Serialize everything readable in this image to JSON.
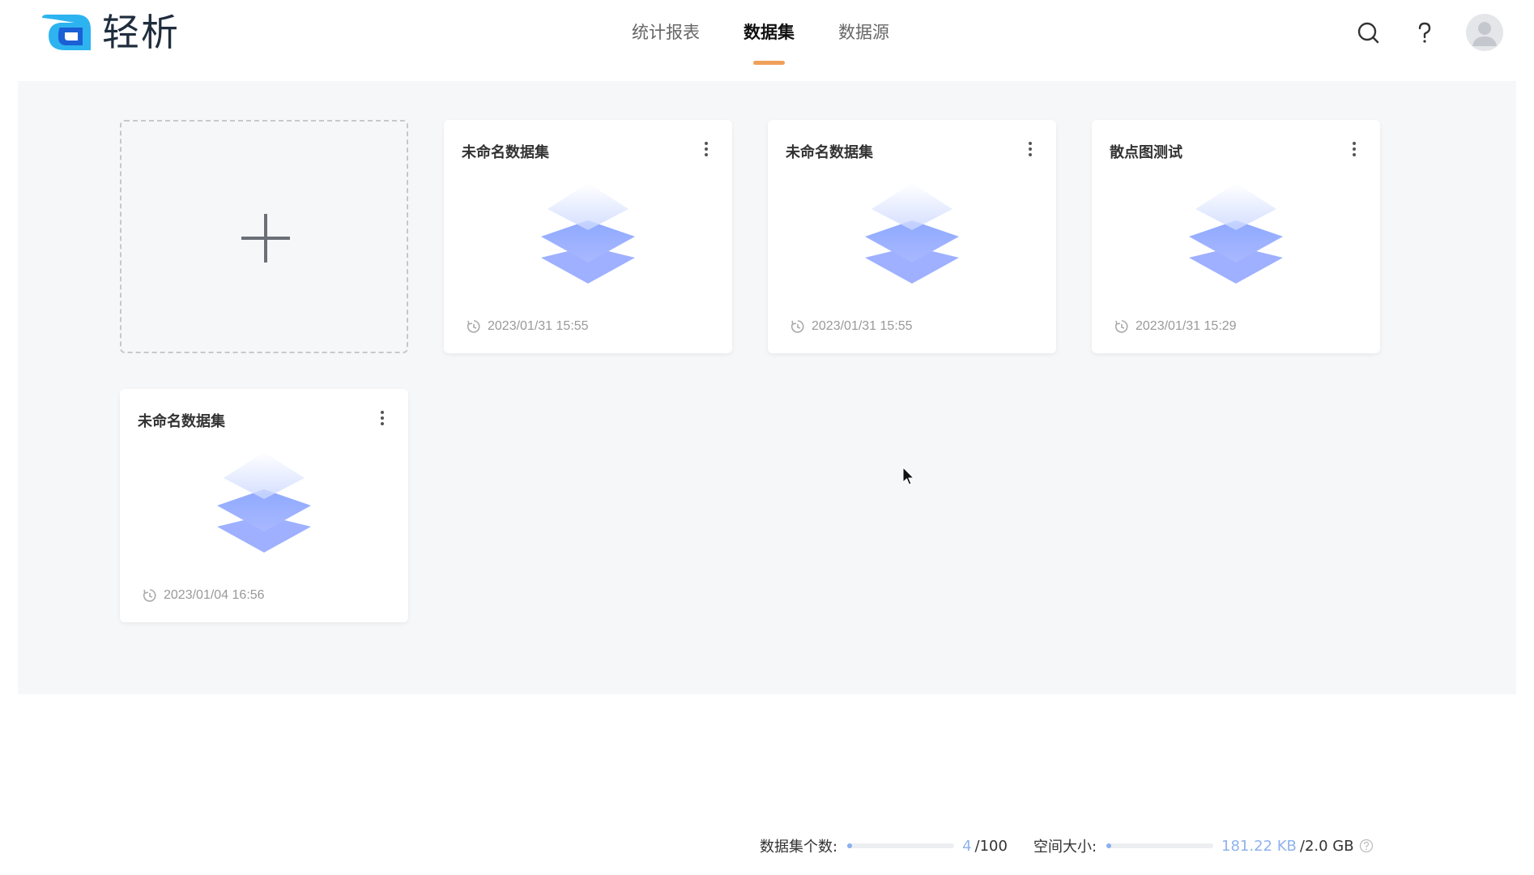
{
  "app": {
    "logo_text": "轻析",
    "brand_colors": {
      "primary": "#2db4f0",
      "dark": "#1b5fd6",
      "accent": "#f0a05a"
    }
  },
  "nav": {
    "tabs": [
      {
        "label": "统计报表",
        "active": false
      },
      {
        "label": "数据集",
        "active": true
      },
      {
        "label": "数据源",
        "active": false
      }
    ]
  },
  "header_icons": [
    "search-icon",
    "help-icon",
    "avatar-icon"
  ],
  "add_card": {
    "icon": "plus-icon"
  },
  "datasets": [
    {
      "title": "未命名数据集",
      "time": "2023/01/31 15:55",
      "icon": "layers-icon"
    },
    {
      "title": "未命名数据集",
      "time": "2023/01/31 15:55",
      "icon": "layers-icon"
    },
    {
      "title": "散点图测试",
      "time": "2023/01/31 15:29",
      "icon": "layers-icon"
    },
    {
      "title": "未命名数据集",
      "time": "2023/01/04 16:56",
      "icon": "layers-icon"
    }
  ],
  "footer": {
    "count_label": "数据集个数:",
    "count_used": "4",
    "count_total": "/100",
    "count_fraction": 0.04,
    "space_label": "空间大小:",
    "space_used": "181.22 KB",
    "space_total": "/2.0 GB",
    "space_fraction": 0.0001
  }
}
